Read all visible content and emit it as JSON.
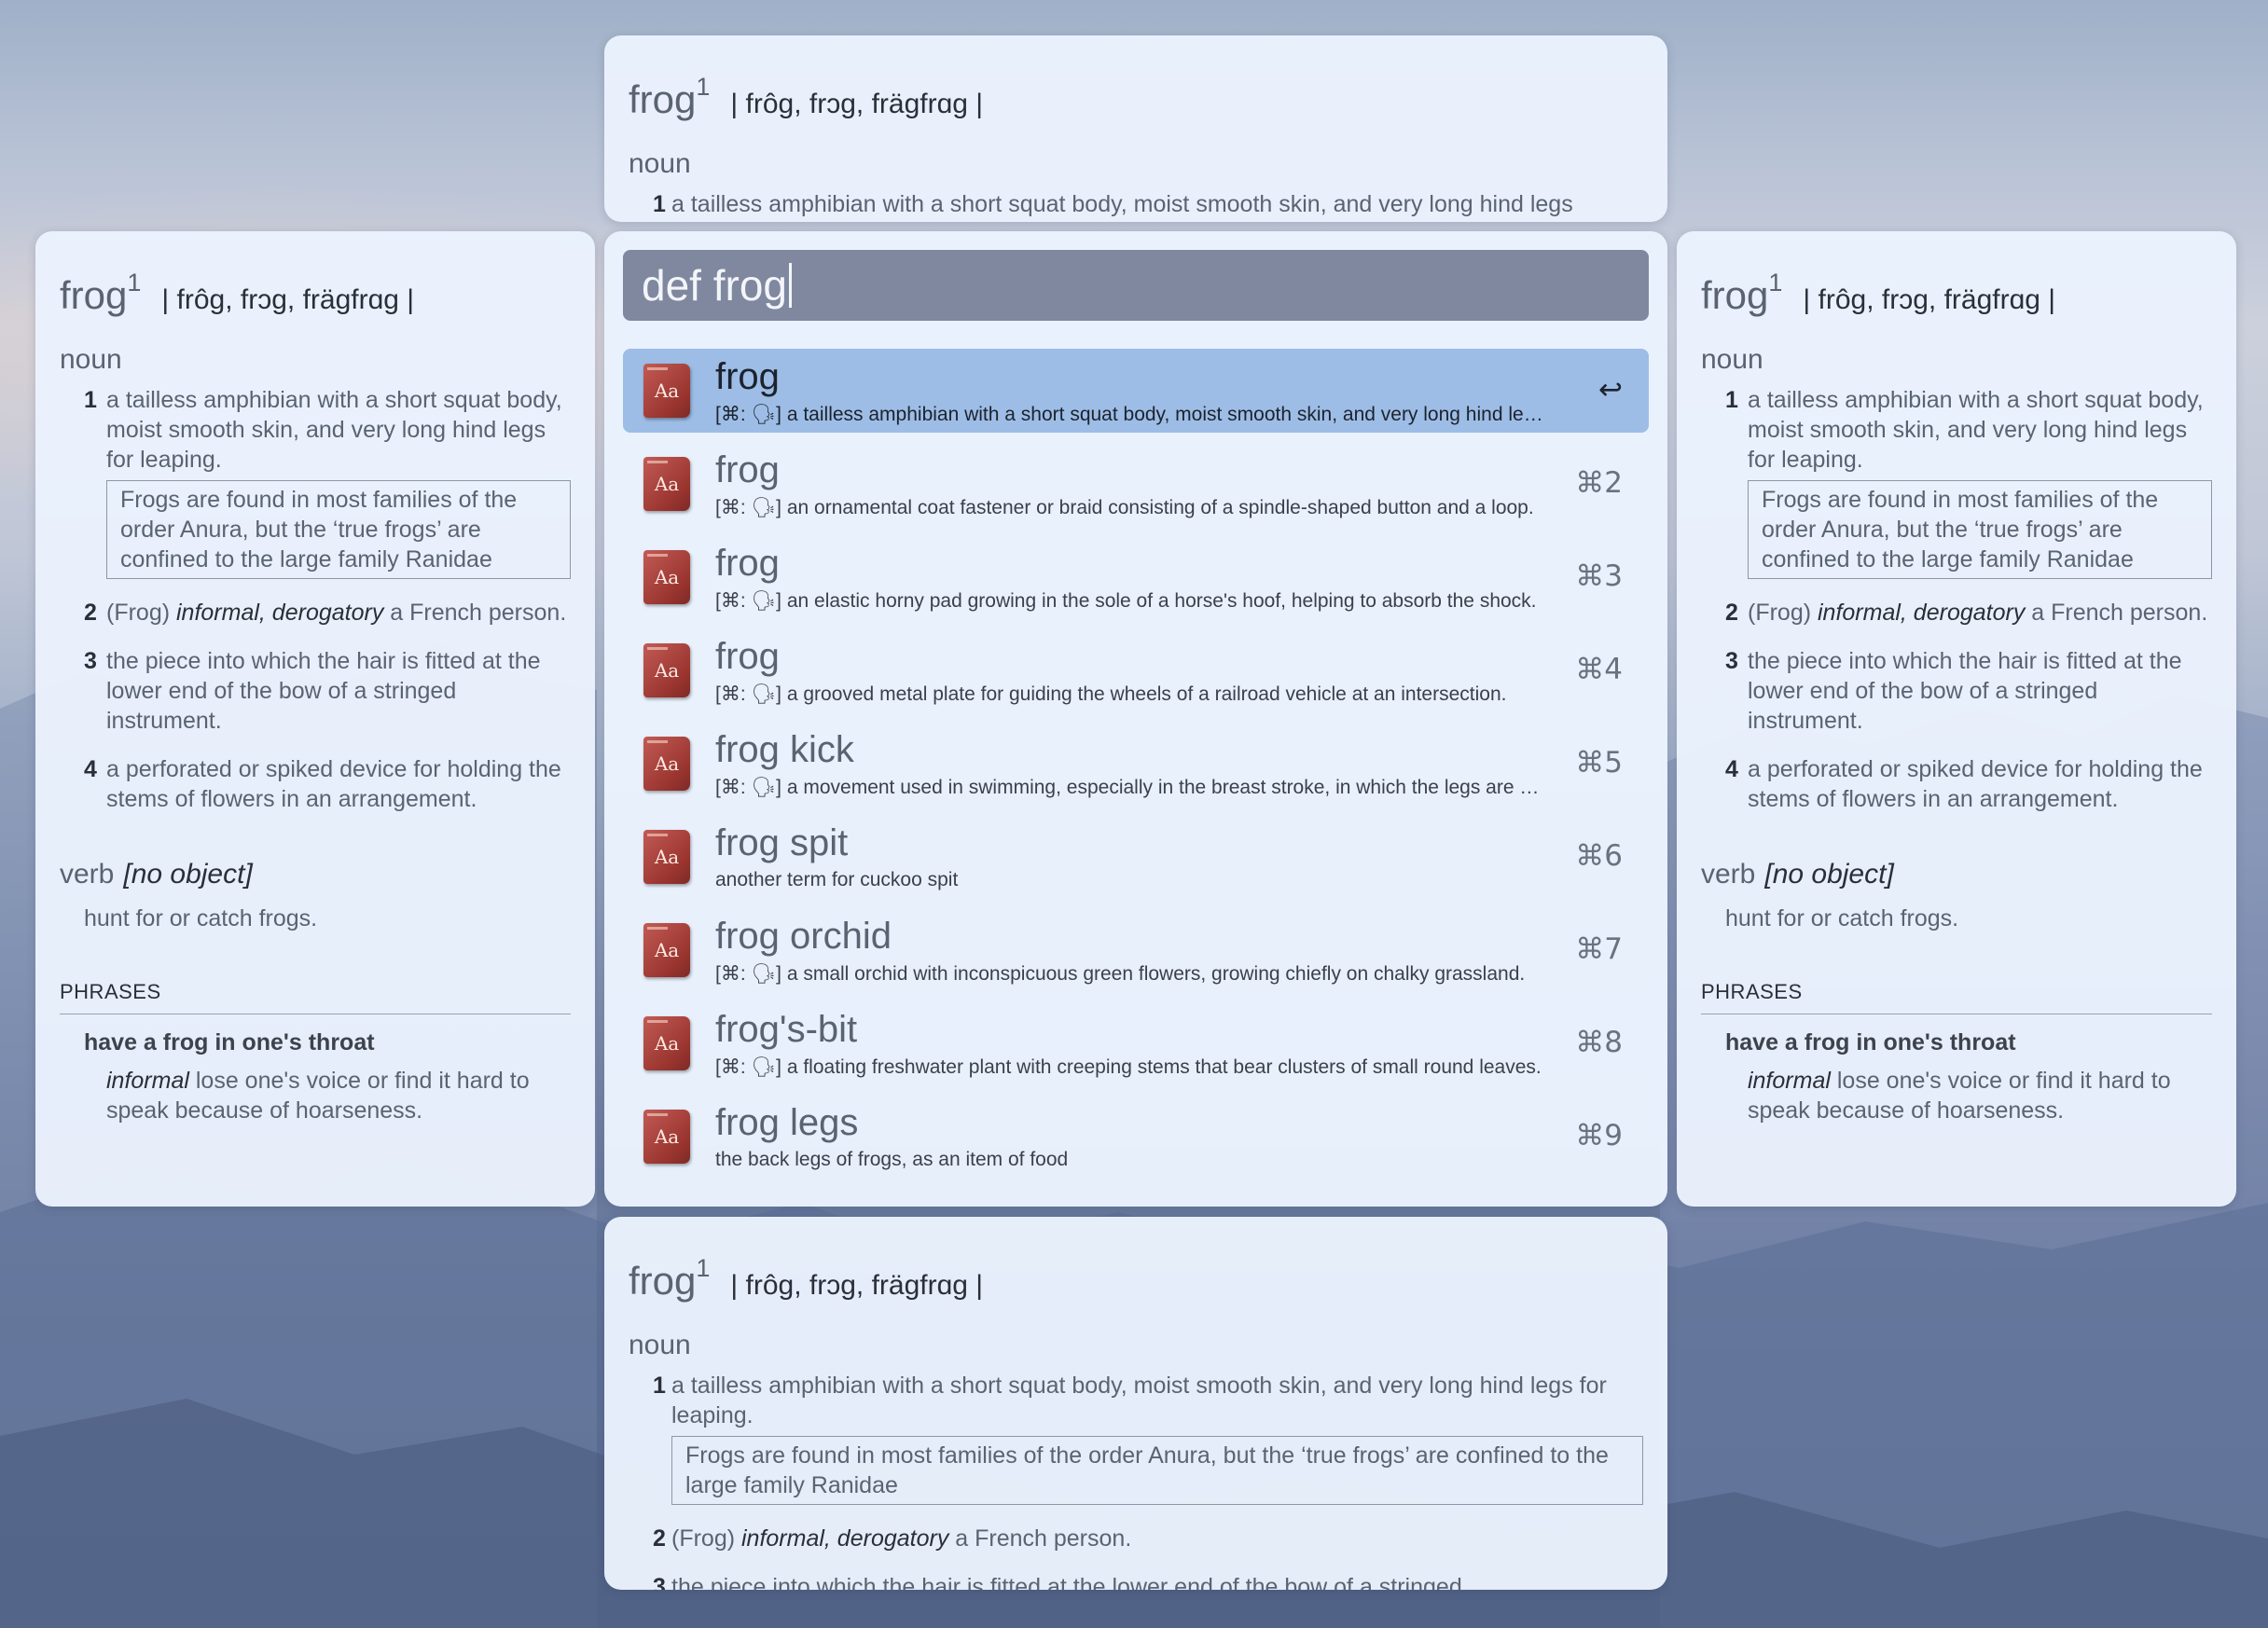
{
  "entry": {
    "headword": "frog",
    "homograph": "1",
    "pronunciation": "| frôg, frɔg, frägfrɑg |",
    "pos_noun": "noun",
    "senses": [
      {
        "num": "1",
        "text": "a tailless amphibian with a short squat body, moist smooth skin, and very long hind legs for leaping."
      },
      {
        "num": "2",
        "text_before": "(Frog) ",
        "label": "informal, derogatory",
        "text_after": " a French person."
      },
      {
        "num": "3",
        "text": "the piece into which the hair is fitted at the lower end of the bow of a stringed instrument."
      },
      {
        "num": "4",
        "text": "a perforated or spiked device for holding the stems of flowers in an arrangement."
      }
    ],
    "note": "Frogs are found in most families of the order Anura, but the ‘true frogs’ are confined to the large family Ranidae",
    "pos_verb": "verb",
    "verb_gram": "[no object]",
    "verb_def": "hunt for or catch frogs.",
    "phrases_heading": "PHRASES",
    "phrase": "have a frog in one's throat",
    "phrase_label": "informal",
    "phrase_def": " lose one's voice or find it hard to speak because of hoarseness.",
    "top_sense_1": "a tailless amphibian with a short squat body, moist smooth skin, and very long hind legs",
    "bottom_sense_3": "the piece into which the hair is fitted at the lower end of the bow of a stringed"
  },
  "launcher": {
    "query": "def frog",
    "icon_text": "Aa",
    "results": [
      {
        "title": "frog",
        "subtitle": "[⌘: 🗣] a tailless amphibian with a short squat body, moist smooth skin, and very long hind legs for leaping.",
        "key": "↩"
      },
      {
        "title": "frog",
        "subtitle": "[⌘: 🗣] an ornamental coat fastener or braid consisting of a spindle-shaped button and a loop.",
        "key": "⌘2"
      },
      {
        "title": "frog",
        "subtitle": "[⌘: 🗣] an elastic horny pad growing in the sole of a horse's hoof, helping to absorb the shock.",
        "key": "⌘3"
      },
      {
        "title": "frog",
        "subtitle": "[⌘: 🗣] a grooved metal plate for guiding the wheels of a railroad vehicle at an intersection.",
        "key": "⌘4"
      },
      {
        "title": "frog kick",
        "subtitle": "[⌘: 🗣] a movement used in swimming, especially in the breast stroke, in which the legs are kicked.",
        "key": "⌘5"
      },
      {
        "title": "frog spit",
        "subtitle": "another term for cuckoo spit",
        "key": "⌘6"
      },
      {
        "title": "frog orchid",
        "subtitle": "[⌘: 🗣] a small orchid with inconspicuous green flowers, growing chiefly on chalky grassland.",
        "key": "⌘7"
      },
      {
        "title": "frog's-bit",
        "subtitle": "[⌘: 🗣] a floating freshwater plant with creeping stems that bear clusters of small round leaves.",
        "key": "⌘8"
      },
      {
        "title": "frog legs",
        "subtitle": "the back legs of frogs, as an item of food",
        "key": "⌘9"
      }
    ]
  }
}
